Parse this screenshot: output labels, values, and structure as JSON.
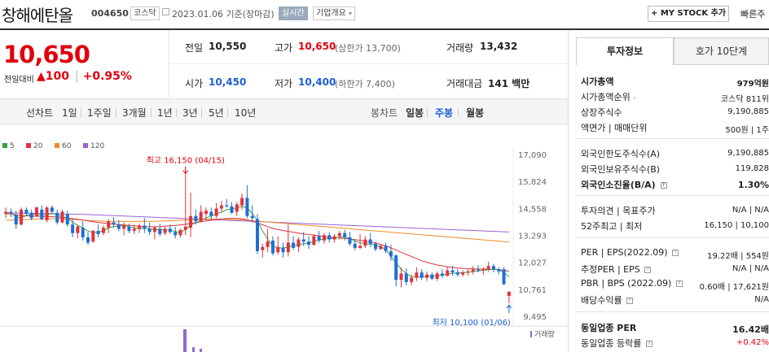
{
  "header": {
    "title": "창해에탄올",
    "code": "004650",
    "market": "코스닥",
    "date": "2023.01.06",
    "basis": "기준(장마감)",
    "realtime": "실시간",
    "corp_overview": "기업개요",
    "my_stock": "MY STOCK 추가",
    "quick": "빠른주"
  },
  "price": {
    "current": "10,650",
    "change_label": "전일대비",
    "change_arrow": "▲",
    "change": "100",
    "change_pct": "+0.95%"
  },
  "quote": {
    "prev_label": "전일",
    "prev": "10,550",
    "high_label": "고가",
    "high": "10,650",
    "upper_limit": "(상한가 13,700)",
    "volume_label": "거래량",
    "volume": "13,432",
    "open_label": "시가",
    "open": "10,450",
    "low_label": "저가",
    "low": "10,400",
    "lower_limit": "(하한가 7,400)",
    "amount_label": "거래대금",
    "amount": "141 백만"
  },
  "periods": {
    "line_chart": "선차트",
    "items": [
      "1일",
      "1주일",
      "3개월",
      "1년",
      "3년",
      "5년",
      "10년"
    ],
    "candle_chart": "봉차트",
    "candle_items": [
      "일봉",
      "주봉",
      "월봉"
    ],
    "active_candle": "주봉"
  },
  "chart_data": {
    "type": "candlestick",
    "legend": [
      {
        "name": "5",
        "color": "#3aa13a"
      },
      {
        "name": "20",
        "color": "#e0343c"
      },
      {
        "name": "60",
        "color": "#f08a24"
      },
      {
        "name": "120",
        "color": "#9a62d6"
      }
    ],
    "y_ticks": [
      "17,090",
      "15,824",
      "14,558",
      "13,293",
      "12,027",
      "10,761",
      "9,495"
    ],
    "ylim": [
      9495,
      17090
    ],
    "annotations": {
      "high": "최고 16,150 (04/15)",
      "low": "최저 10,100 (01/06)"
    },
    "volume_label": "거래량",
    "candles": [
      [
        14300,
        14600,
        14100,
        14400
      ],
      [
        14400,
        14550,
        14150,
        14350
      ],
      [
        14250,
        14450,
        13600,
        13800
      ],
      [
        13800,
        14600,
        13750,
        14500
      ],
      [
        14500,
        14600,
        14200,
        14300
      ],
      [
        14350,
        14500,
        14000,
        14100
      ],
      [
        14200,
        14650,
        14150,
        14600
      ],
      [
        14500,
        14700,
        14000,
        14050
      ],
      [
        14000,
        14650,
        13900,
        14600
      ],
      [
        14600,
        14700,
        14300,
        14400
      ],
      [
        14350,
        14500,
        13800,
        13900
      ],
      [
        13900,
        14500,
        13850,
        14400
      ],
      [
        14300,
        14450,
        13700,
        13800
      ],
      [
        13800,
        14050,
        13200,
        13400
      ],
      [
        13400,
        13800,
        13150,
        13700
      ],
      [
        13650,
        13950,
        13050,
        13200
      ],
      [
        13200,
        13450,
        12850,
        12950
      ],
      [
        13000,
        13550,
        12950,
        13500
      ],
      [
        13500,
        13800,
        13200,
        13350
      ],
      [
        13400,
        13750,
        13300,
        13650
      ],
      [
        13650,
        14050,
        13400,
        13950
      ],
      [
        13900,
        14150,
        13650,
        13800
      ],
      [
        13800,
        14000,
        13500,
        13600
      ],
      [
        13600,
        13900,
        13300,
        13750
      ],
      [
        13700,
        13850,
        13400,
        13500
      ],
      [
        13500,
        13800,
        13350,
        13600
      ],
      [
        13600,
        13850,
        13400,
        13750
      ],
      [
        13750,
        14100,
        13400,
        13600
      ],
      [
        13600,
        13900,
        13300,
        13450
      ],
      [
        13450,
        13750,
        13100,
        13650
      ],
      [
        13600,
        13850,
        13250,
        13350
      ],
      [
        13400,
        13700,
        13300,
        13600
      ],
      [
        13600,
        13800,
        13350,
        13450
      ],
      [
        13450,
        13700,
        13150,
        13300
      ],
      [
        13300,
        13600,
        13200,
        13550
      ],
      [
        13550,
        16150,
        13300,
        13700
      ],
      [
        13650,
        15300,
        13200,
        14200
      ],
      [
        14200,
        14500,
        13800,
        13950
      ],
      [
        13950,
        14700,
        13900,
        14400
      ],
      [
        14300,
        14600,
        14000,
        14450
      ],
      [
        14400,
        14600,
        14050,
        14200
      ],
      [
        14200,
        14800,
        14100,
        14550
      ],
      [
        14550,
        14900,
        14400,
        14700
      ],
      [
        14700,
        15000,
        14600,
        14650
      ],
      [
        14650,
        14850,
        14300,
        14350
      ],
      [
        14400,
        14850,
        14200,
        14750
      ],
      [
        14700,
        15250,
        14500,
        15050
      ],
      [
        15050,
        15650,
        14100,
        14200
      ],
      [
        14200,
        14700,
        13900,
        14100
      ],
      [
        14050,
        14300,
        12400,
        12550
      ],
      [
        12600,
        12900,
        12250,
        12750
      ],
      [
        12750,
        13600,
        12500,
        13000
      ],
      [
        13050,
        13250,
        12350,
        12450
      ],
      [
        12500,
        13250,
        12400,
        12750
      ],
      [
        12700,
        12950,
        12250,
        12500
      ],
      [
        12500,
        13800,
        12300,
        12950
      ],
      [
        12950,
        13250,
        12600,
        12700
      ],
      [
        12750,
        13200,
        12500,
        13100
      ],
      [
        13100,
        13450,
        12800,
        13000
      ],
      [
        13000,
        13250,
        12650,
        12850
      ],
      [
        12850,
        13350,
        12800,
        13250
      ],
      [
        13250,
        13500,
        12950,
        13050
      ],
      [
        13050,
        13400,
        12900,
        13300
      ],
      [
        13300,
        13450,
        12950,
        13100
      ],
      [
        13100,
        13350,
        12950,
        13250
      ],
      [
        13250,
        13500,
        13100,
        13400
      ],
      [
        13400,
        13550,
        13050,
        13200
      ],
      [
        13200,
        13450,
        12800,
        12900
      ],
      [
        12900,
        13100,
        12600,
        12700
      ],
      [
        12700,
        13350,
        12650,
        12800
      ],
      [
        12800,
        13250,
        12700,
        13100
      ],
      [
        13100,
        13400,
        12750,
        12900
      ],
      [
        12900,
        13000,
        12550,
        12650
      ],
      [
        12650,
        12900,
        12600,
        12800
      ],
      [
        12800,
        12950,
        12450,
        12550
      ],
      [
        12550,
        12850,
        12100,
        12300
      ],
      [
        12350,
        12400,
        10900,
        11200
      ],
      [
        11200,
        11800,
        10850,
        11500
      ],
      [
        11500,
        11750,
        10950,
        11100
      ],
      [
        11100,
        11450,
        10950,
        11300
      ],
      [
        11300,
        11800,
        11150,
        11550
      ],
      [
        11550,
        11700,
        11200,
        11300
      ],
      [
        11300,
        11600,
        11150,
        11450
      ],
      [
        11450,
        11550,
        11200,
        11250
      ],
      [
        11250,
        11600,
        11150,
        11500
      ],
      [
        11500,
        11700,
        11300,
        11400
      ],
      [
        11400,
        11800,
        11350,
        11650
      ],
      [
        11650,
        11850,
        11400,
        11550
      ],
      [
        11550,
        11700,
        11350,
        11450
      ],
      [
        11450,
        11650,
        11350,
        11550
      ],
      [
        11550,
        11700,
        11400,
        11600
      ],
      [
        11600,
        11850,
        11450,
        11700
      ],
      [
        11700,
        11900,
        11550,
        11650
      ],
      [
        11650,
        11800,
        11450,
        11700
      ],
      [
        11700,
        12050,
        11600,
        11850
      ],
      [
        11850,
        11950,
        11550,
        11700
      ],
      [
        11700,
        11800,
        11450,
        11600
      ],
      [
        11700,
        11800,
        10950,
        11000
      ],
      [
        10450,
        10650,
        10100,
        10650
      ]
    ],
    "ma_lines": [
      {
        "name": "5",
        "values": [
          14300,
          14350,
          14150,
          14120,
          14220,
          14300,
          14280,
          14260,
          14250,
          14320,
          14250,
          14160,
          14110,
          13920,
          13760,
          13640,
          13500,
          13420,
          13450,
          13500,
          13640,
          13700,
          13740,
          13760,
          13700,
          13640,
          13600,
          13630,
          13600,
          13560,
          13560,
          13550,
          13530,
          13470,
          13420,
          13580,
          13780,
          13880,
          14000,
          14100,
          14200,
          14300,
          14380,
          14500,
          14520,
          14580,
          14650,
          14580,
          14320,
          14000,
          13500,
          13100,
          12800,
          12700,
          12700,
          12750,
          12800,
          12850,
          12900,
          12950,
          13000,
          13080,
          13120,
          13150,
          13150,
          13200,
          13220,
          13150,
          13020,
          12940,
          12900,
          12880,
          12830,
          12760,
          12620,
          12300,
          12000,
          11700,
          11500,
          11350,
          11330,
          11350,
          11360,
          11390,
          11400,
          11420,
          11470,
          11510,
          11530,
          11540,
          11560,
          11590,
          11620,
          11650,
          11680,
          11700,
          11680,
          11560,
          11350
        ]
      },
      {
        "name": "20",
        "values": [
          14300,
          14300,
          14250,
          14220,
          14210,
          14200,
          14190,
          14180,
          14170,
          14170,
          14150,
          14130,
          14110,
          14080,
          14050,
          14010,
          13970,
          13930,
          13900,
          13870,
          13840,
          13820,
          13800,
          13780,
          13760,
          13740,
          13720,
          13710,
          13700,
          13690,
          13700,
          13720,
          13740,
          13760,
          13780,
          13810,
          13850,
          13890,
          13930,
          13970,
          14000,
          14030,
          14060,
          14080,
          14090,
          14090,
          14070,
          14030,
          13960,
          13880,
          13790,
          13700,
          13620,
          13560,
          13520,
          13480,
          13440,
          13400,
          13360,
          13330,
          13300,
          13270,
          13240,
          13210,
          13190,
          13170,
          13150,
          13120,
          13090,
          13060,
          13020,
          12980,
          12930,
          12870,
          12800,
          12700,
          12600,
          12500,
          12400,
          12300,
          12200,
          12100,
          12030,
          11960,
          11900,
          11860,
          11820,
          11790,
          11760,
          11740,
          11730,
          11720,
          11710,
          11710,
          11700,
          11690,
          11680,
          11650,
          11600
        ]
      },
      {
        "name": "60",
        "values": [
          14000,
          14010,
          14020,
          14030,
          14040,
          14050,
          14060,
          14060,
          14070,
          14070,
          14070,
          14060,
          14050,
          14040,
          14030,
          14010,
          13990,
          13980,
          13970,
          13960,
          13950,
          13950,
          13950,
          13950,
          13950,
          13950,
          13950,
          13950,
          13950,
          13950,
          13960,
          13970,
          13980,
          13990,
          14000,
          14010,
          14020,
          14030,
          14040,
          14050,
          14060,
          14060,
          14060,
          14050,
          14040,
          14030,
          14020,
          14000,
          13980,
          13960,
          13940,
          13920,
          13900,
          13880,
          13860,
          13840,
          13820,
          13800,
          13780,
          13760,
          13740,
          13720,
          13700,
          13680,
          13660,
          13640,
          13620,
          13600,
          13580,
          13560,
          13540,
          13520,
          13500,
          13480,
          13460,
          13440,
          13420,
          13400,
          13380,
          13360,
          13340,
          13320,
          13300,
          13280,
          13260,
          13240,
          13220,
          13200,
          13180,
          13160,
          13140,
          13120,
          13100,
          13080,
          13060,
          13040,
          13020,
          13000,
          12980
        ]
      },
      {
        "name": "120",
        "values": [
          14350,
          14350,
          14340,
          14340,
          14330,
          14330,
          14320,
          14320,
          14310,
          14310,
          14300,
          14300,
          14290,
          14290,
          14280,
          14280,
          14270,
          14260,
          14250,
          14240,
          14230,
          14220,
          14210,
          14200,
          14190,
          14180,
          14170,
          14160,
          14150,
          14140,
          14130,
          14120,
          14110,
          14100,
          14090,
          14080,
          14070,
          14060,
          14050,
          14040,
          14030,
          14020,
          14010,
          14000,
          13990,
          13980,
          13970,
          13960,
          13950,
          13940,
          13930,
          13920,
          13910,
          13900,
          13890,
          13880,
          13870,
          13860,
          13850,
          13840,
          13830,
          13820,
          13810,
          13800,
          13790,
          13780,
          13770,
          13760,
          13750,
          13740,
          13730,
          13720,
          13710,
          13700,
          13690,
          13680,
          13670,
          13660,
          13650,
          13640,
          13630,
          13620,
          13610,
          13600,
          13590,
          13580,
          13570,
          13560,
          13550,
          13540,
          13530,
          13520,
          13510,
          13500,
          13490,
          13480,
          13470,
          13460,
          13450
        ]
      }
    ]
  },
  "invest_panel": {
    "tab_info": "투자정보",
    "tab_hoga": "호가 10단계",
    "rows": [
      {
        "label": "시가총액",
        "value": "979억원"
      },
      {
        "label": "시가총액순위",
        "value": "코스닥 811위"
      },
      {
        "label": "상장주식수",
        "value": "9,190,885"
      },
      {
        "label": "액면가 | 매매단위",
        "value": "500원 | 1주"
      },
      {
        "label": "외국인한도주식수(A)",
        "value": "9,190,885"
      },
      {
        "label": "외국인보유주식수(B)",
        "value": "119,828"
      },
      {
        "label": "외국인소진율(B/A)",
        "value": "1.30%"
      },
      {
        "label": "투자의견 | 목표주가",
        "value": "N/A | N/A"
      },
      {
        "label": "52주최고 | 최저",
        "value": "16,150 | 10,100"
      },
      {
        "label": "PER | EPS(2022.09)",
        "value": "19.22배 | 554원"
      },
      {
        "label": "추정PER | EPS",
        "value": "N/A | N/A"
      },
      {
        "label": "PBR | BPS (2022.09)",
        "value": "0.60배 | 17,621원"
      },
      {
        "label": "배당수익률",
        "value": "N/A"
      },
      {
        "label": "동일업종 PER",
        "value": "16.42배"
      },
      {
        "label": "동일업종 등락률",
        "value": "+0.42%"
      }
    ]
  }
}
